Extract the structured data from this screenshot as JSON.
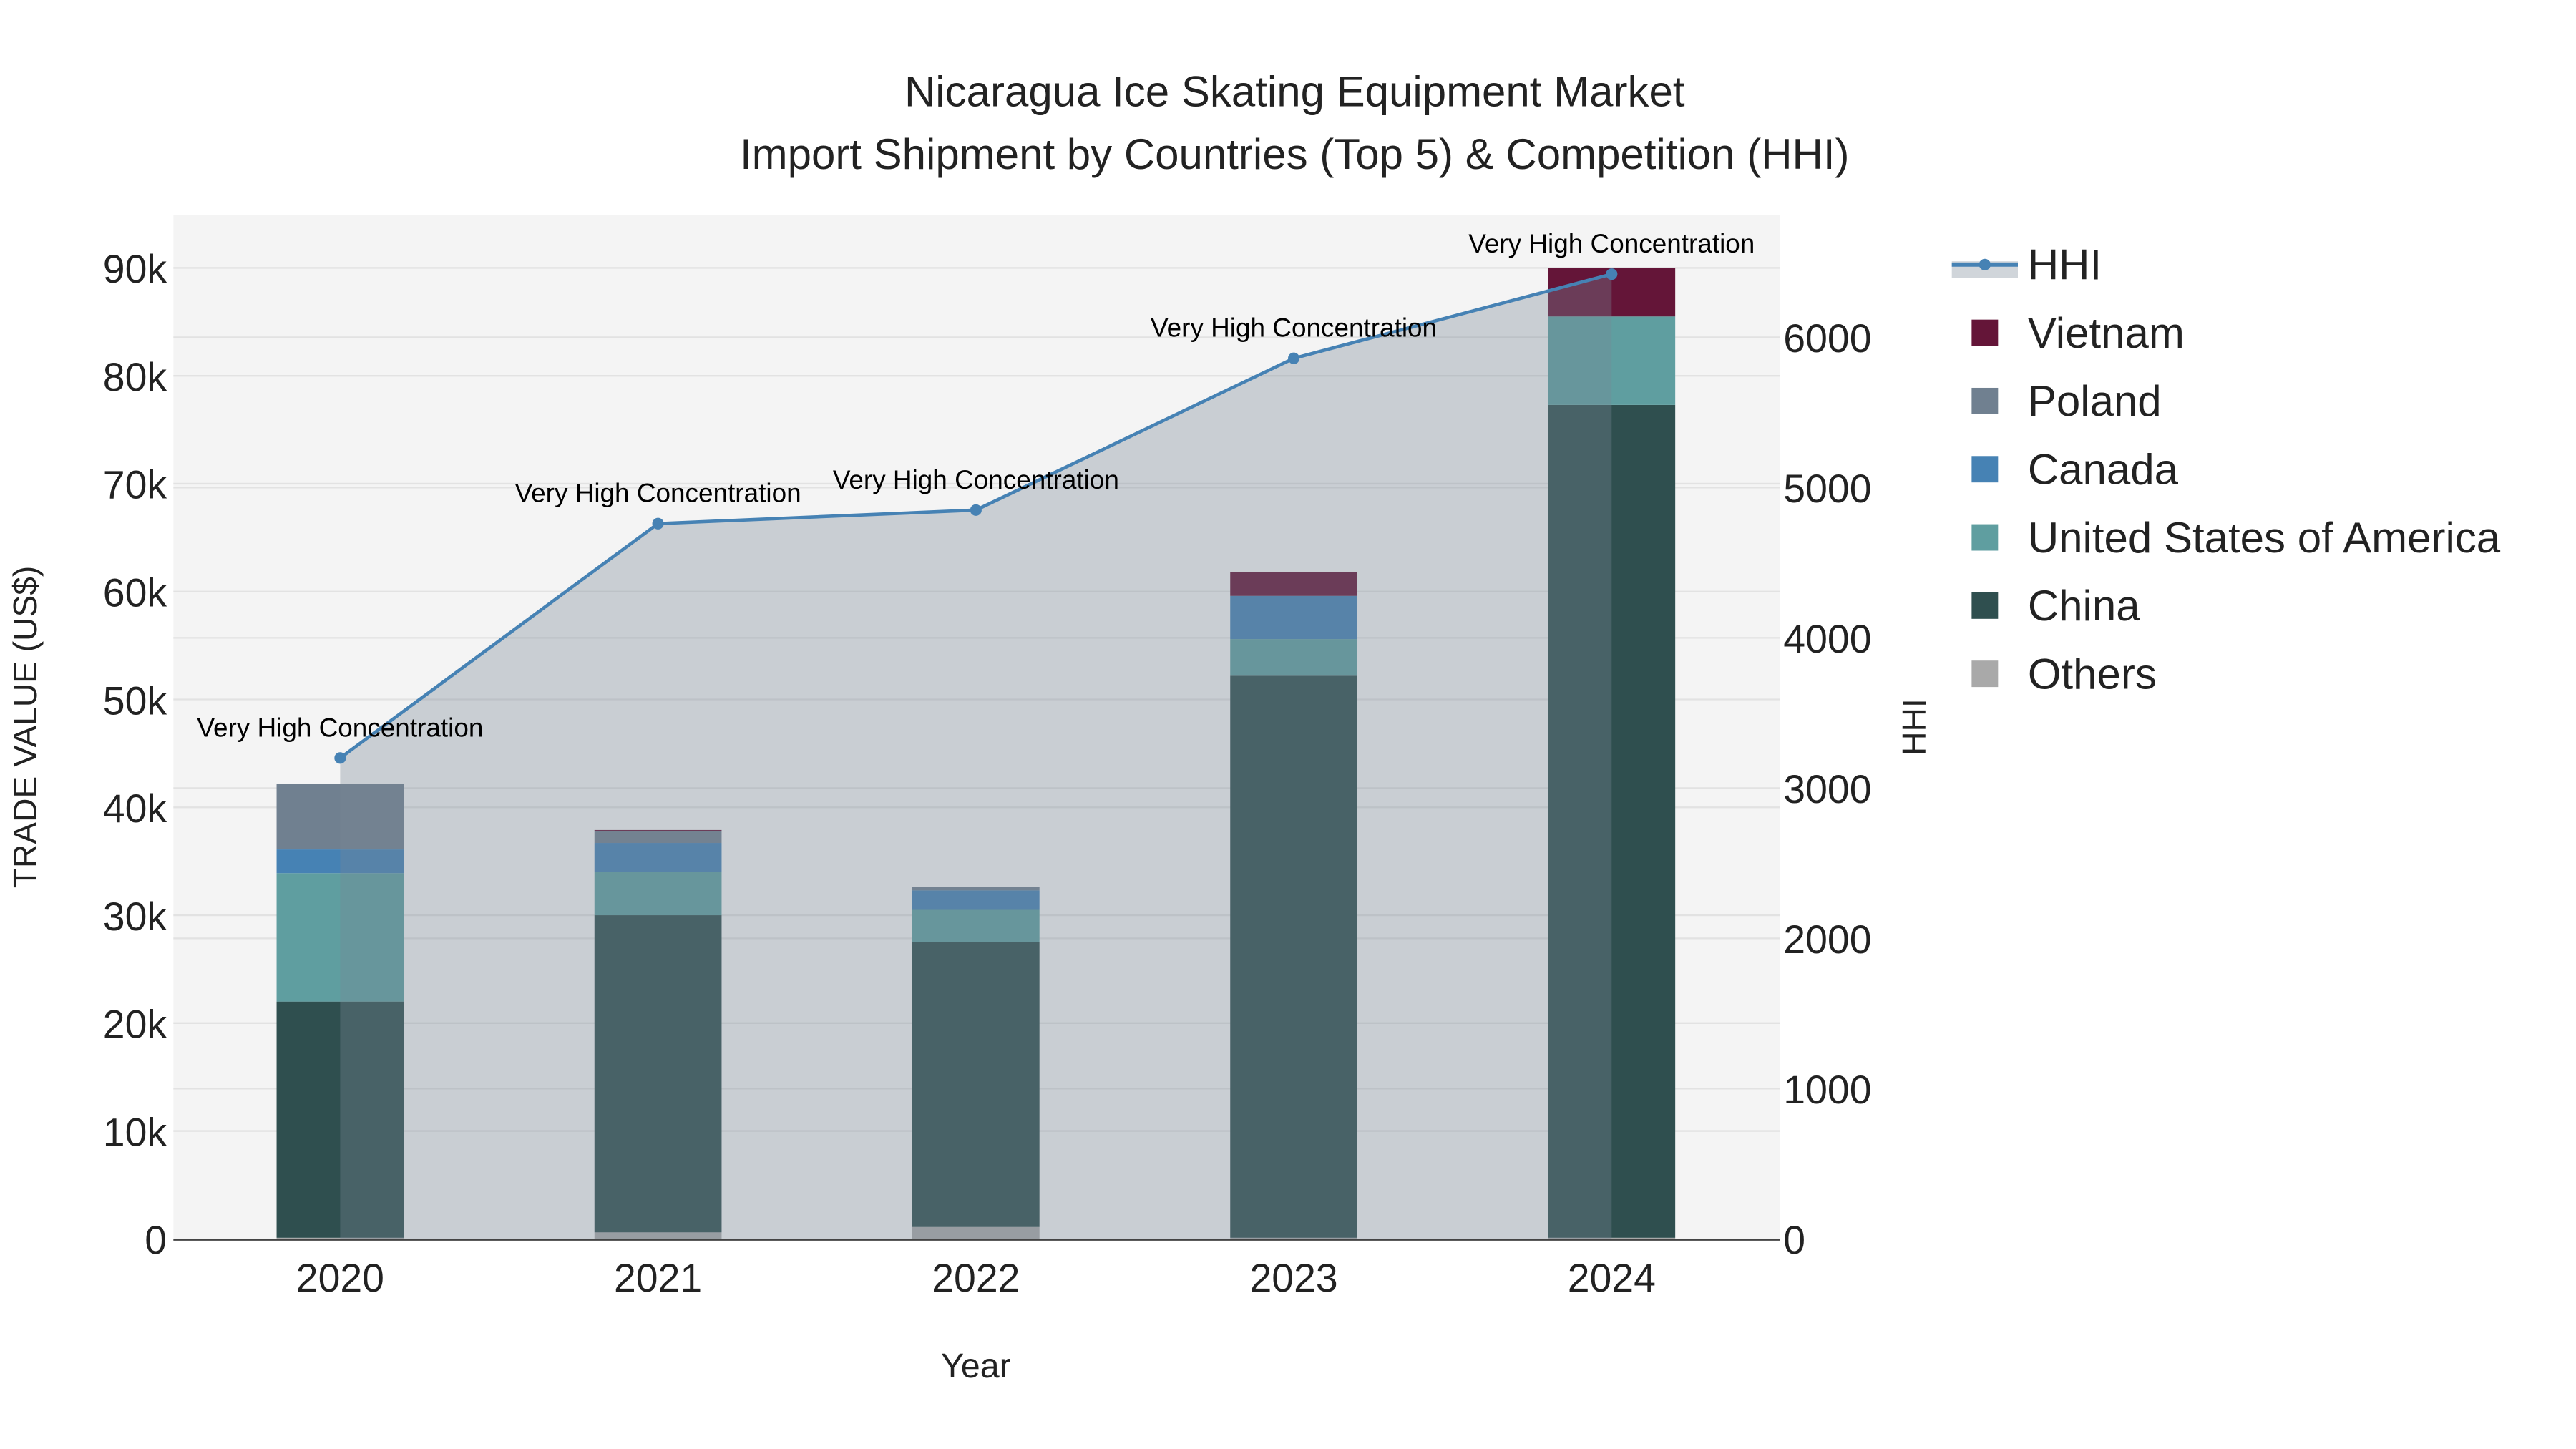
{
  "chart_data": {
    "type": "bar",
    "barmode": "stack",
    "title": "Nicaragua Ice Skating Equipment Market",
    "subtitle": "Import Shipment by Countries (Top 5) & Competition (HHI)",
    "xlabel": "Year",
    "ylabel": "TRADE VALUE (US$)",
    "y2label": "HHI",
    "categories": [
      "2020",
      "2021",
      "2022",
      "2023",
      "2024"
    ],
    "ylim": [
      0,
      95000
    ],
    "y_ticks": [
      0,
      10000,
      20000,
      30000,
      40000,
      50000,
      60000,
      70000,
      80000,
      90000
    ],
    "y_tick_labels": [
      "0",
      "10k",
      "20k",
      "30k",
      "40k",
      "50k",
      "60k",
      "70k",
      "80k",
      "90k"
    ],
    "y2_ticks": [
      0,
      1000,
      2000,
      3000,
      4000,
      5000,
      6000
    ],
    "y2_tick_labels": [
      "0",
      "1000",
      "2000",
      "3000",
      "4000",
      "5000",
      "6000"
    ],
    "series": [
      {
        "name": "Others",
        "color": "#a9a9a9",
        "values": [
          100,
          600,
          1100,
          100,
          100
        ]
      },
      {
        "name": "China",
        "color": "#2f4f4f",
        "values": [
          21900,
          29400,
          26400,
          52100,
          77200
        ]
      },
      {
        "name": "United States of America",
        "color": "#5f9ea0",
        "values": [
          11900,
          4000,
          3000,
          3400,
          8200
        ]
      },
      {
        "name": "Canada",
        "color": "#4682b4",
        "values": [
          2200,
          2700,
          1800,
          4000,
          0
        ]
      },
      {
        "name": "Poland",
        "color": "#708090",
        "values": [
          6100,
          1100,
          300,
          0,
          0
        ]
      },
      {
        "name": "Vietnam",
        "color": "#641538",
        "values": [
          0,
          100,
          0,
          2200,
          4500
        ]
      }
    ],
    "hhi": {
      "name": "HHI",
      "color": "#4682b4",
      "values": [
        3200,
        4760,
        4850,
        5860,
        6420
      ],
      "labels": [
        "Very High Concentration",
        "Very High Concentration",
        "Very High Concentration",
        "Very High Concentration",
        "Very High Concentration"
      ]
    },
    "legend": {
      "placement": "right",
      "order": [
        "HHI",
        "Vietnam",
        "Poland",
        "Canada",
        "United States of America",
        "China",
        "Others"
      ]
    },
    "grid": true
  }
}
